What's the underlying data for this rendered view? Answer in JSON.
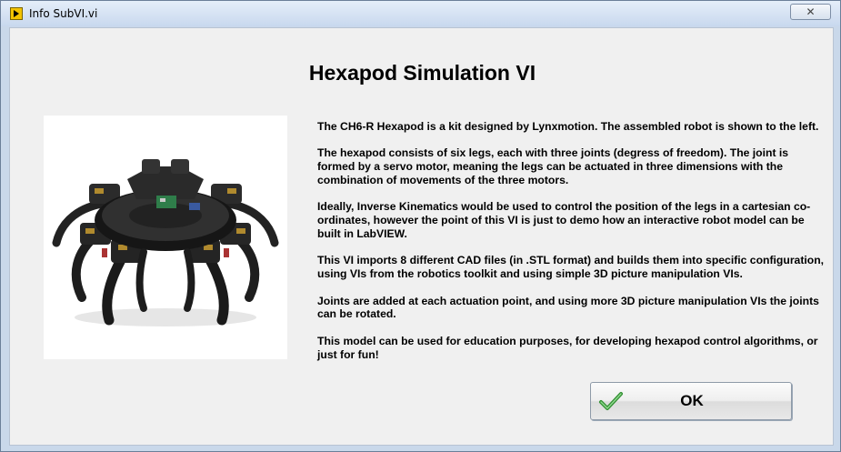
{
  "window": {
    "title": "Info SubVI.vi",
    "close_glyph": "✕",
    "icon": "labview-vi-icon"
  },
  "dialog": {
    "heading": "Hexapod Simulation VI",
    "image": "hexapod-robot-photo",
    "paragraphs": [
      "The CH6-R Hexapod is a kit designed by Lynxmotion. The assembled robot is shown to the left.",
      "The hexapod consists of six legs, each with three joints (degress of freedom). The joint is formed by a servo motor, meaning the legs can be actuated in three dimensions with the combination of movements of the three motors.",
      "Ideally, Inverse Kinematics would be used to control the position of the legs in a cartesian co-ordinates, however the point of this VI is just to demo how an interactive robot model can be built in LabVIEW.",
      "This VI imports 8 different CAD files (in .STL format) and builds them into specific configuration, using VIs from the robotics toolkit and using simple 3D picture manipulation VIs.",
      "Joints are added at each actuation point, and using more 3D picture manipulation VIs the joints can be rotated.",
      "This model can be used for education purposes, for developing hexapod control algorithms, or just for fun!"
    ],
    "ok_label": "OK",
    "ok_icon": "checkmark-icon"
  }
}
